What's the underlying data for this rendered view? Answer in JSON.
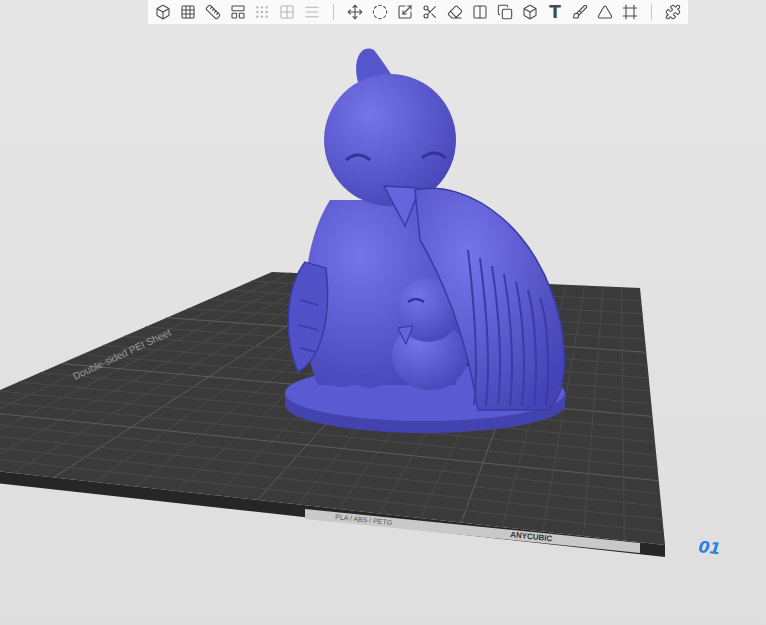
{
  "toolbar": {
    "groups": [
      {
        "buttons": [
          {
            "disabled": false
          },
          {
            "disabled": false
          },
          {
            "disabled": false
          },
          {
            "disabled": false
          }
        ]
      },
      {
        "buttons": [
          {
            "disabled": true
          },
          {
            "disabled": true
          },
          {
            "disabled": true
          }
        ]
      },
      {
        "buttons": [
          {
            "disabled": false
          },
          {
            "disabled": false
          },
          {
            "disabled": false
          },
          {
            "disabled": false
          },
          {
            "disabled": false
          },
          {
            "disabled": false
          },
          {
            "disabled": false
          },
          {
            "disabled": false
          },
          {
            "disabled": false,
            "label": "T"
          },
          {
            "disabled": false
          },
          {
            "disabled": false
          },
          {
            "disabled": false
          }
        ]
      },
      {
        "buttons": [
          {
            "disabled": false
          }
        ]
      }
    ]
  },
  "plate": {
    "sheet_label": "Double-sided PEI Sheet",
    "material_label": "PLA / ABS / PETG",
    "brand_label": "ANYCUBIC",
    "plate_number": "01"
  }
}
